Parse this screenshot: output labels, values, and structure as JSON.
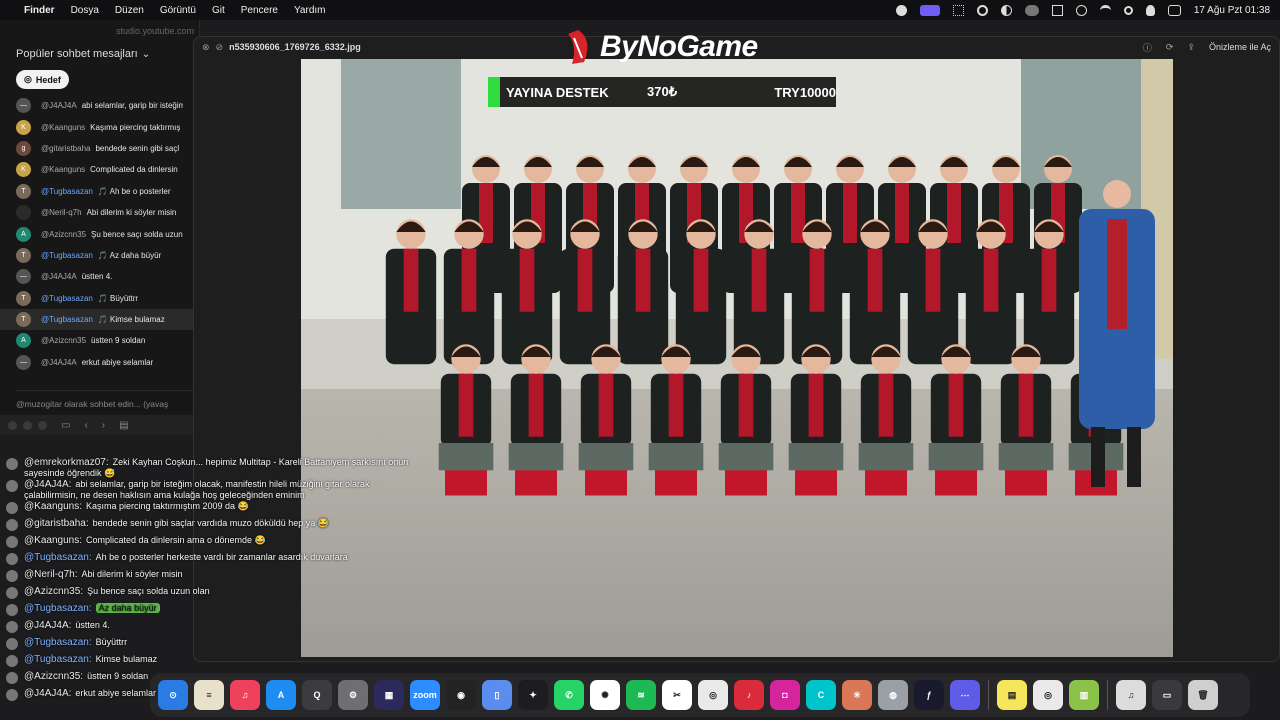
{
  "menubar": {
    "items": [
      "Finder",
      "Dosya",
      "Düzen",
      "Görüntü",
      "Git",
      "Pencere",
      "Yardım"
    ],
    "clock": "17 Ağu Pzt  01:38"
  },
  "chat_window": {
    "url": "studio.youtube.com",
    "header": "Popüler sohbet mesajları",
    "hedef_label": "Hedef",
    "input_placeholder": "@muzogitar olarak sohbet edin... (yavaş",
    "messages": [
      {
        "author": "@J4AJ4A",
        "text": "abi selamlar, garip bir isteğim olacak, çalabilirmisin, ne desen haklısın ama k",
        "mod": false,
        "color": "#555555",
        "initial": "—"
      },
      {
        "author": "@Kaanguns",
        "text": "Kaşıma piercing taktırmış",
        "mod": false,
        "color": "#c9a34a",
        "initial": "K"
      },
      {
        "author": "@gitaristbaha",
        "text": "bendede senin gibi saçl",
        "mod": false,
        "color": "#6b4a3a",
        "initial": "g"
      },
      {
        "author": "@Kaanguns",
        "text": "Complicated da dinlersin",
        "mod": false,
        "color": "#c9a34a",
        "initial": "K"
      },
      {
        "author": "@Tugbasazan",
        "text": "🎵  Ah be o posterler",
        "mod": true,
        "color": "#7a6a5a",
        "initial": "T"
      },
      {
        "author": "@Neril-q7h",
        "text": "Abi dilerim ki söyler misin",
        "mod": false,
        "color": "#2b2b2b",
        "initial": ""
      },
      {
        "author": "@Azizcnn35",
        "text": "Şu bence saçı solda uzun",
        "mod": false,
        "color": "#1f8a70",
        "initial": "A"
      },
      {
        "author": "@Tugbasazan",
        "text": "🎵  Az daha büyür",
        "mod": true,
        "color": "#7a6a5a",
        "initial": "T"
      },
      {
        "author": "@J4AJ4A",
        "text": "üstten 4.",
        "mod": false,
        "color": "#555555",
        "initial": "—"
      },
      {
        "author": "@Tugbasazan",
        "text": "🎵  Büyüttrr",
        "mod": true,
        "color": "#7a6a5a",
        "initial": "T"
      },
      {
        "author": "@Tugbasazan",
        "text": "🎵  Kimse bulamaz",
        "mod": true,
        "color": "#7a6a5a",
        "initial": "T"
      },
      {
        "author": "@Azizcnn35",
        "text": "üstten 9 soldan",
        "mod": false,
        "color": "#1f8a70",
        "initial": "A"
      },
      {
        "author": "@J4AJ4A",
        "text": "erkut abiye selamlar",
        "mod": false,
        "color": "#555555",
        "initial": "—"
      }
    ]
  },
  "preview": {
    "file_name": "n535930606_1769726_6332.jpg",
    "open_label": "Önizleme ile Aç"
  },
  "overlay": {
    "logo": "ByNoGame",
    "donation_title": "YAYINA DESTEK",
    "donation_amount": "370₺",
    "donation_goal": "TRY10000"
  },
  "overlay_chat": [
    {
      "author": "@emrekorkmaz07:",
      "text": "Zeki Kayhan Coşkun... hepimiz Multitap - Kareli Battaniyem şarkısını onun sayesinde öğrendik 😅",
      "mod": false,
      "green": false
    },
    {
      "author": "@J4AJ4A:",
      "text": "abi selamlar, garip bir isteğim olacak, manifestin hileli müziğini gitar olarak çalabilirmisin, ne desen haklısın ama kulağa hoş geleceğinden eminim",
      "mod": false,
      "green": false
    },
    {
      "author": "@Kaanguns:",
      "text": "Kaşıma piercing taktırmıştım 2009 da 😂",
      "mod": false,
      "green": false
    },
    {
      "author": "@gitaristbaha:",
      "text": "bendede senin gibi saçlar vardıda muzo döküldü hep ya 😂",
      "mod": false,
      "green": false
    },
    {
      "author": "@Kaanguns:",
      "text": "Complicated da dinlersin ama o dönemde 😂",
      "mod": false,
      "green": false
    },
    {
      "author": "@Tugbasazan:",
      "text": "Ah be o posterler herkeste vardı bir zamanlar asardık duvarlara",
      "mod": true,
      "green": false
    },
    {
      "author": "@Neril-q7h:",
      "text": "Abi dilerim ki söyler misin",
      "mod": false,
      "green": false
    },
    {
      "author": "@Azizcnn35:",
      "text": "Şu bence saçı solda uzun olan",
      "mod": false,
      "green": false
    },
    {
      "author": "@Tugbasazan:",
      "text": "Az daha büyür",
      "mod": true,
      "green": true
    },
    {
      "author": "@J4AJ4A:",
      "text": "üstten 4.",
      "mod": false,
      "green": false
    },
    {
      "author": "@Tugbasazan:",
      "text": "Büyüttrr",
      "mod": true,
      "green": false
    },
    {
      "author": "@Tugbasazan:",
      "text": "Kimse bulamaz",
      "mod": true,
      "green": false
    },
    {
      "author": "@Azizcnn35:",
      "text": "üstten 9 soldan",
      "mod": false,
      "green": false
    },
    {
      "author": "@J4AJ4A:",
      "text": "erkut abiye selamlar",
      "mod": false,
      "green": false
    }
  ],
  "dock": [
    {
      "name": "safari-icon",
      "color": "#2a7be4",
      "glyph": "⊙"
    },
    {
      "name": "notes-icon",
      "color": "#e8e0c8",
      "glyph": "≡"
    },
    {
      "name": "music-icon",
      "color": "#f0415c",
      "glyph": "♫"
    },
    {
      "name": "app-store-icon",
      "color": "#1e8cf0",
      "glyph": "A"
    },
    {
      "name": "quicktime-icon",
      "color": "#3c3c3e",
      "glyph": "Q"
    },
    {
      "name": "system-settings-icon",
      "color": "#6e6e73",
      "glyph": "⚙"
    },
    {
      "name": "stream-deck-icon",
      "color": "#2b2a5a",
      "glyph": "▦"
    },
    {
      "name": "zoom-icon",
      "color": "#2d8cff",
      "glyph": "zoom"
    },
    {
      "name": "obs-icon",
      "color": "#232323",
      "glyph": "◉"
    },
    {
      "name": "preview-icon",
      "color": "#5b8def",
      "glyph": "▯"
    },
    {
      "name": "final-cut-icon",
      "color": "#1d1d1f",
      "glyph": "✦"
    },
    {
      "name": "whatsapp-icon",
      "color": "#25d366",
      "glyph": "✆"
    },
    {
      "name": "chatgpt-icon",
      "color": "#ffffff",
      "glyph": "✺"
    },
    {
      "name": "spotify-icon",
      "color": "#1db954",
      "glyph": "≋"
    },
    {
      "name": "capcut-icon",
      "color": "#ffffff",
      "glyph": "✂"
    },
    {
      "name": "chrome-icon",
      "color": "#e9e9e9",
      "glyph": "◎"
    },
    {
      "name": "music-app-icon",
      "color": "#d92b3a",
      "glyph": "♪"
    },
    {
      "name": "instagram-icon",
      "color": "#d6249f",
      "glyph": "◘"
    },
    {
      "name": "canva-icon",
      "color": "#00c4cc",
      "glyph": "C"
    },
    {
      "name": "claude-icon",
      "color": "#d97757",
      "glyph": "✳"
    },
    {
      "name": "launchpad-icon",
      "color": "#9aa0a6",
      "glyph": "◍"
    },
    {
      "name": "script-icon",
      "color": "#1a1a2e",
      "glyph": "ƒ"
    },
    {
      "name": "apps-grid-icon",
      "color": "#5e5ce6",
      "glyph": "⋯"
    },
    {
      "name": "sep",
      "color": "",
      "glyph": ""
    },
    {
      "name": "stickies-icon",
      "color": "#f5e65c",
      "glyph": "▤"
    },
    {
      "name": "chrome-alt-icon",
      "color": "#e9e9e9",
      "glyph": "◎"
    },
    {
      "name": "numbers-icon",
      "color": "#8bc34a",
      "glyph": "▥"
    },
    {
      "name": "sep",
      "color": "",
      "glyph": ""
    },
    {
      "name": "document-icon",
      "color": "#dcdcdc",
      "glyph": "♫"
    },
    {
      "name": "folder-icon",
      "color": "#3a3a3c",
      "glyph": "▭"
    },
    {
      "name": "trash-icon",
      "color": "#cfcfcf",
      "glyph": "🗑"
    }
  ]
}
